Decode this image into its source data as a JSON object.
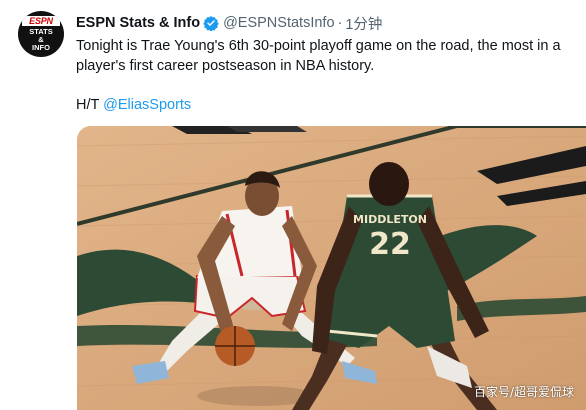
{
  "author": {
    "display_name": "ESPN Stats & Info",
    "handle": "@ESPNStatsInfo",
    "separator": "·",
    "time": "1分钟",
    "avatar": {
      "brand": "ESPN",
      "line1": "STATS",
      "line2": "&",
      "line3": "INFO"
    }
  },
  "tweet": {
    "text": "Tonight is Trae Young's 6th 30-point playoff game on the road, the most in a player's first career postseason in NBA history.",
    "ht_prefix": "H/T ",
    "ht_mention": "@EliasSports"
  },
  "media": {
    "jersey_left_number": "",
    "jersey_right_name": "MIDDLETON",
    "jersey_right_number": "22",
    "watermark": "百家号/超哥爱侃球"
  },
  "colors": {
    "link": "#1d9bf0",
    "verified": "#1d9bf0",
    "bucks_green": "#2c4a34",
    "court": "#d8a779"
  }
}
